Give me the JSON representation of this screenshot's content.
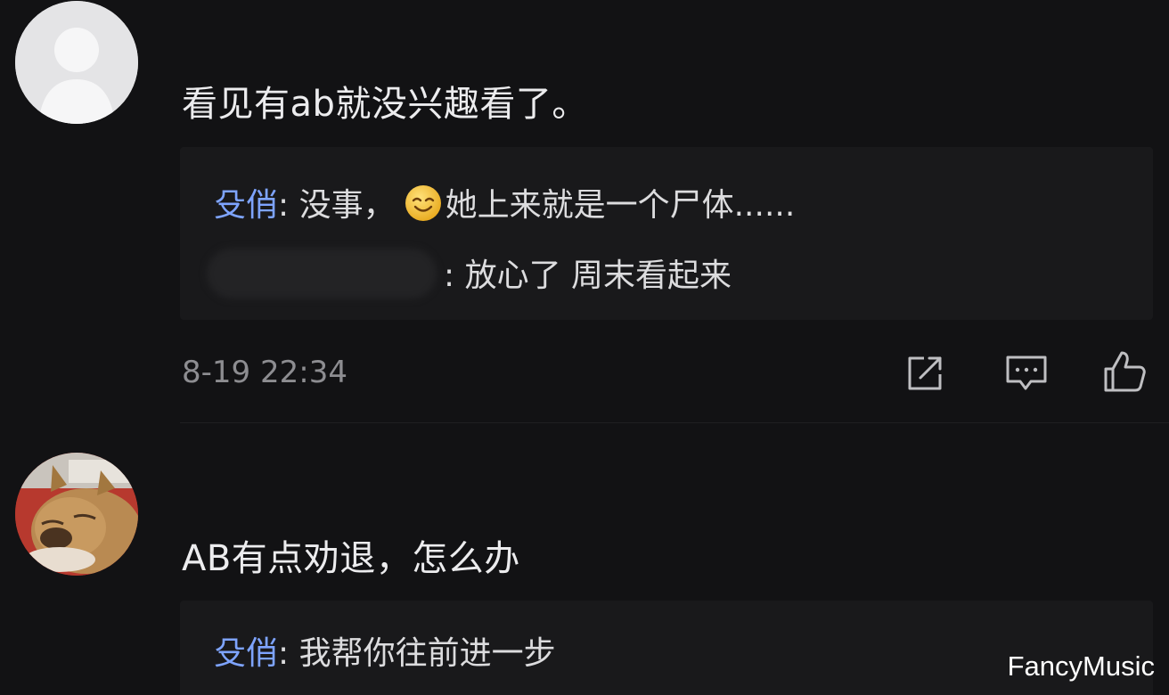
{
  "comments": [
    {
      "avatar_icon": "default-avatar-icon",
      "text": "看见有ab就没兴趣看了。",
      "replies": [
        {
          "name": "殳俏",
          "separator": ": ",
          "prefix": "没事，",
          "emoji": "smiling-face-emoji",
          "text": "她上来就是一个尸体......"
        },
        {
          "name_hidden": true,
          "separator": ": ",
          "text": "放心了  周末看起来"
        }
      ],
      "timestamp": "8-19 22:34",
      "actions": [
        "share-icon",
        "comment-icon",
        "like-icon"
      ]
    },
    {
      "avatar_icon": "dog-avatar-icon",
      "text": "AB有点劝退，怎么办",
      "replies": [
        {
          "name": "殳俏",
          "separator": ": ",
          "text": "我帮你往前进一步"
        }
      ]
    }
  ],
  "watermark": "FancyMusic",
  "colors": {
    "background": "#121214",
    "reply_background": "#19191b",
    "reply_name": "#7ea4ff",
    "timestamp": "#8d8d91"
  }
}
